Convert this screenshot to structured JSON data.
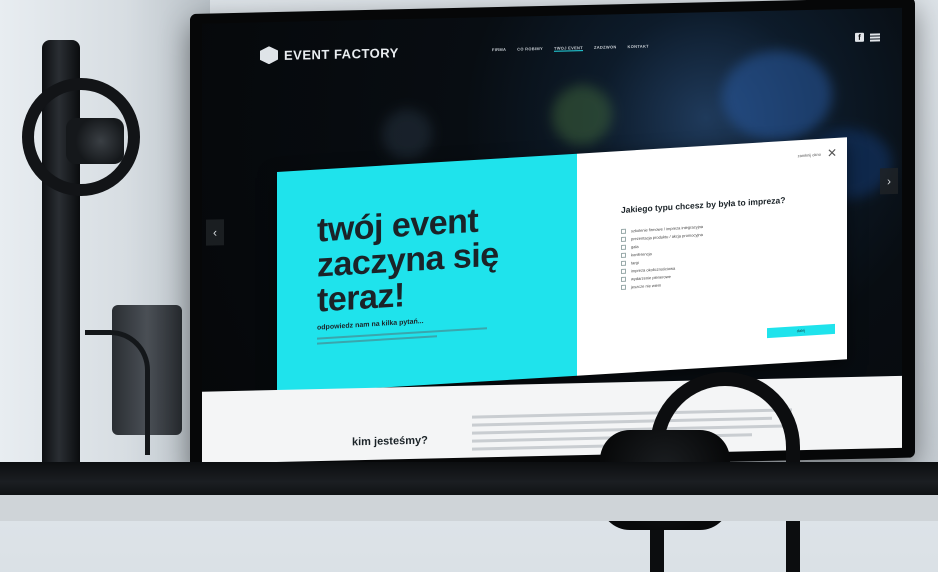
{
  "site": {
    "brand": "EVENT FACTORY",
    "menu": [
      "FIRMA",
      "CO ROBIMY",
      "TWOJ EVENT",
      "ZADZWON",
      "KONTAKT"
    ],
    "menu_active_index": 2,
    "social_icon": "facebook-icon",
    "menu_icon": "hamburger-icon"
  },
  "modal": {
    "headline": "twój event zaczyna się teraz!",
    "subheadline": "odpowiedz nam na kilka pytań...",
    "close_label": "zamknij okno",
    "question": "Jakiego typu chcesz by była to impreza?",
    "options": [
      "szkolenie firmowe / impreza integracyjna",
      "prezentacja produktu / akcja promocyjna",
      "gala",
      "konferencja",
      "targi",
      "impreza okolicznościowa",
      "wydarzenie plenerowe",
      "jeszcze nie wiem"
    ],
    "next_label": "dalej",
    "accent_color": "#1fe3ec"
  },
  "section": {
    "heading": "kim jesteśmy?"
  }
}
